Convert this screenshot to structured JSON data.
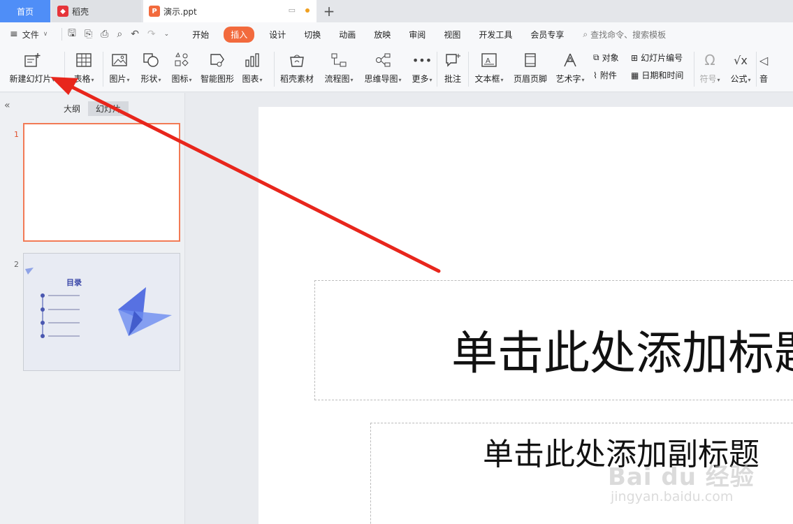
{
  "tabs": {
    "home": "首页",
    "daoke": "稻壳",
    "doc": "演示.ppt",
    "add": "+"
  },
  "menu": {
    "file": "文件",
    "tabs": [
      "开始",
      "插入",
      "设计",
      "切换",
      "动画",
      "放映",
      "审阅",
      "视图",
      "开发工具",
      "会员专享"
    ],
    "active_tab": "插入",
    "search": "查找命令、搜索模板"
  },
  "ribbon": {
    "new_slide": "新建幻灯片",
    "table": "表格",
    "picture": "图片",
    "shape": "形状",
    "icon": "图标",
    "smart_art": "智能图形",
    "chart": "图表",
    "daoke_material": "稻壳素材",
    "flowchart": "流程图",
    "mindmap": "思维导图",
    "more": "更多",
    "comment": "批注",
    "textbox": "文本框",
    "header_footer": "页眉页脚",
    "wordart": "艺术字",
    "object": "对象",
    "attachment": "附件",
    "slide_number": "幻灯片编号",
    "datetime": "日期和时间",
    "symbol": "符号",
    "formula": "公式",
    "audio": "音"
  },
  "panel": {
    "outline_tab": "大纲",
    "slides_tab": "幻灯片",
    "slide1_num": "1",
    "slide2_num": "2",
    "thumb2_title": "目录"
  },
  "slide": {
    "title_placeholder": "单击此处添加标题",
    "subtitle_placeholder": "单击此处添加副标题"
  },
  "watermark": {
    "brand": "Bai du 经验",
    "url": "jingyan.baidu.com"
  },
  "colors": {
    "accent": "#f26a3d",
    "home_tab": "#4f8ef7",
    "arrow": "#e8261c",
    "selected_border": "#f27a55"
  }
}
